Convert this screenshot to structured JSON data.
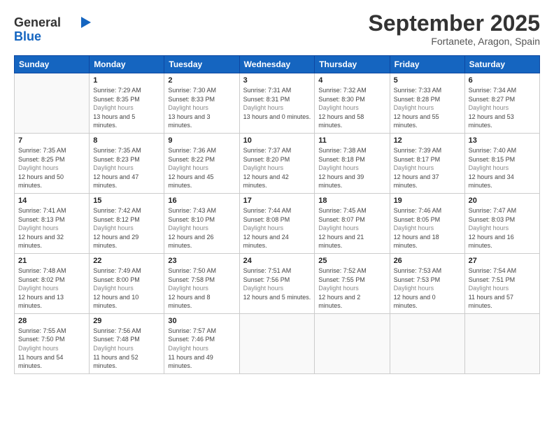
{
  "header": {
    "logo_line1": "General",
    "logo_line2": "Blue",
    "month": "September 2025",
    "location": "Fortanete, Aragon, Spain"
  },
  "weekdays": [
    "Sunday",
    "Monday",
    "Tuesday",
    "Wednesday",
    "Thursday",
    "Friday",
    "Saturday"
  ],
  "weeks": [
    [
      {
        "day": "",
        "info": ""
      },
      {
        "day": "1",
        "sunrise": "7:29 AM",
        "sunset": "8:35 PM",
        "daylight": "13 hours and 5 minutes."
      },
      {
        "day": "2",
        "sunrise": "7:30 AM",
        "sunset": "8:33 PM",
        "daylight": "13 hours and 3 minutes."
      },
      {
        "day": "3",
        "sunrise": "7:31 AM",
        "sunset": "8:31 PM",
        "daylight": "13 hours and 0 minutes."
      },
      {
        "day": "4",
        "sunrise": "7:32 AM",
        "sunset": "8:30 PM",
        "daylight": "12 hours and 58 minutes."
      },
      {
        "day": "5",
        "sunrise": "7:33 AM",
        "sunset": "8:28 PM",
        "daylight": "12 hours and 55 minutes."
      },
      {
        "day": "6",
        "sunrise": "7:34 AM",
        "sunset": "8:27 PM",
        "daylight": "12 hours and 53 minutes."
      }
    ],
    [
      {
        "day": "7",
        "sunrise": "7:35 AM",
        "sunset": "8:25 PM",
        "daylight": "12 hours and 50 minutes."
      },
      {
        "day": "8",
        "sunrise": "7:35 AM",
        "sunset": "8:23 PM",
        "daylight": "12 hours and 47 minutes."
      },
      {
        "day": "9",
        "sunrise": "7:36 AM",
        "sunset": "8:22 PM",
        "daylight": "12 hours and 45 minutes."
      },
      {
        "day": "10",
        "sunrise": "7:37 AM",
        "sunset": "8:20 PM",
        "daylight": "12 hours and 42 minutes."
      },
      {
        "day": "11",
        "sunrise": "7:38 AM",
        "sunset": "8:18 PM",
        "daylight": "12 hours and 39 minutes."
      },
      {
        "day": "12",
        "sunrise": "7:39 AM",
        "sunset": "8:17 PM",
        "daylight": "12 hours and 37 minutes."
      },
      {
        "day": "13",
        "sunrise": "7:40 AM",
        "sunset": "8:15 PM",
        "daylight": "12 hours and 34 minutes."
      }
    ],
    [
      {
        "day": "14",
        "sunrise": "7:41 AM",
        "sunset": "8:13 PM",
        "daylight": "12 hours and 32 minutes."
      },
      {
        "day": "15",
        "sunrise": "7:42 AM",
        "sunset": "8:12 PM",
        "daylight": "12 hours and 29 minutes."
      },
      {
        "day": "16",
        "sunrise": "7:43 AM",
        "sunset": "8:10 PM",
        "daylight": "12 hours and 26 minutes."
      },
      {
        "day": "17",
        "sunrise": "7:44 AM",
        "sunset": "8:08 PM",
        "daylight": "12 hours and 24 minutes."
      },
      {
        "day": "18",
        "sunrise": "7:45 AM",
        "sunset": "8:07 PM",
        "daylight": "12 hours and 21 minutes."
      },
      {
        "day": "19",
        "sunrise": "7:46 AM",
        "sunset": "8:05 PM",
        "daylight": "12 hours and 18 minutes."
      },
      {
        "day": "20",
        "sunrise": "7:47 AM",
        "sunset": "8:03 PM",
        "daylight": "12 hours and 16 minutes."
      }
    ],
    [
      {
        "day": "21",
        "sunrise": "7:48 AM",
        "sunset": "8:02 PM",
        "daylight": "12 hours and 13 minutes."
      },
      {
        "day": "22",
        "sunrise": "7:49 AM",
        "sunset": "8:00 PM",
        "daylight": "12 hours and 10 minutes."
      },
      {
        "day": "23",
        "sunrise": "7:50 AM",
        "sunset": "7:58 PM",
        "daylight": "12 hours and 8 minutes."
      },
      {
        "day": "24",
        "sunrise": "7:51 AM",
        "sunset": "7:56 PM",
        "daylight": "12 hours and 5 minutes."
      },
      {
        "day": "25",
        "sunrise": "7:52 AM",
        "sunset": "7:55 PM",
        "daylight": "12 hours and 2 minutes."
      },
      {
        "day": "26",
        "sunrise": "7:53 AM",
        "sunset": "7:53 PM",
        "daylight": "12 hours and 0 minutes."
      },
      {
        "day": "27",
        "sunrise": "7:54 AM",
        "sunset": "7:51 PM",
        "daylight": "11 hours and 57 minutes."
      }
    ],
    [
      {
        "day": "28",
        "sunrise": "7:55 AM",
        "sunset": "7:50 PM",
        "daylight": "11 hours and 54 minutes."
      },
      {
        "day": "29",
        "sunrise": "7:56 AM",
        "sunset": "7:48 PM",
        "daylight": "11 hours and 52 minutes."
      },
      {
        "day": "30",
        "sunrise": "7:57 AM",
        "sunset": "7:46 PM",
        "daylight": "11 hours and 49 minutes."
      },
      {
        "day": "",
        "info": ""
      },
      {
        "day": "",
        "info": ""
      },
      {
        "day": "",
        "info": ""
      },
      {
        "day": "",
        "info": ""
      }
    ]
  ]
}
